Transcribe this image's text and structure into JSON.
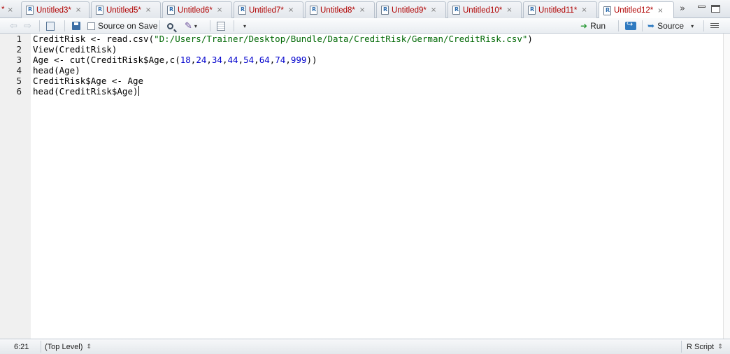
{
  "tabs": {
    "partial": {
      "label": "*",
      "close": "×"
    },
    "items": [
      {
        "label": "Untitled3*",
        "close": "×"
      },
      {
        "label": "Untitled5*",
        "close": "×"
      },
      {
        "label": "Untitled6*",
        "close": "×"
      },
      {
        "label": "Untitled7*",
        "close": "×"
      },
      {
        "label": "Untitled8*",
        "close": "×"
      },
      {
        "label": "Untitled9*",
        "close": "×"
      },
      {
        "label": "Untitled10*",
        "close": "×"
      },
      {
        "label": "Untitled11*",
        "close": "×"
      },
      {
        "label": "Untitled12*",
        "close": "×"
      }
    ],
    "active_index": 8,
    "overflow_glyph": "»"
  },
  "toolbar": {
    "source_on_save_label": "Source on Save",
    "source_on_save_checked": false,
    "run_label": "Run",
    "source_label": "Source",
    "dropdown_glyph": "▾"
  },
  "editor": {
    "line_numbers": [
      "1",
      "2",
      "3",
      "4",
      "5",
      "6"
    ],
    "lines": [
      "CreditRisk <- read.csv(\"D:/Users/Trainer/Desktop/Bundle/Data/CreditRisk/German/CreditRisk.csv\")",
      "View(CreditRisk)",
      "Age <- cut(CreditRisk$Age,c(18,24,34,44,54,64,74,999))",
      "head(Age)",
      "CreditRisk$Age <- Age",
      "head(CreditRisk$Age)"
    ]
  },
  "status": {
    "position": "6:21",
    "scope": "(Top Level)",
    "file_type": "R Script",
    "updown_glyph": "⇕"
  },
  "colors": {
    "tab_label": "#b00000",
    "string": "#036a07",
    "number": "#0000cd",
    "run_arrow": "#2e9b3a"
  }
}
